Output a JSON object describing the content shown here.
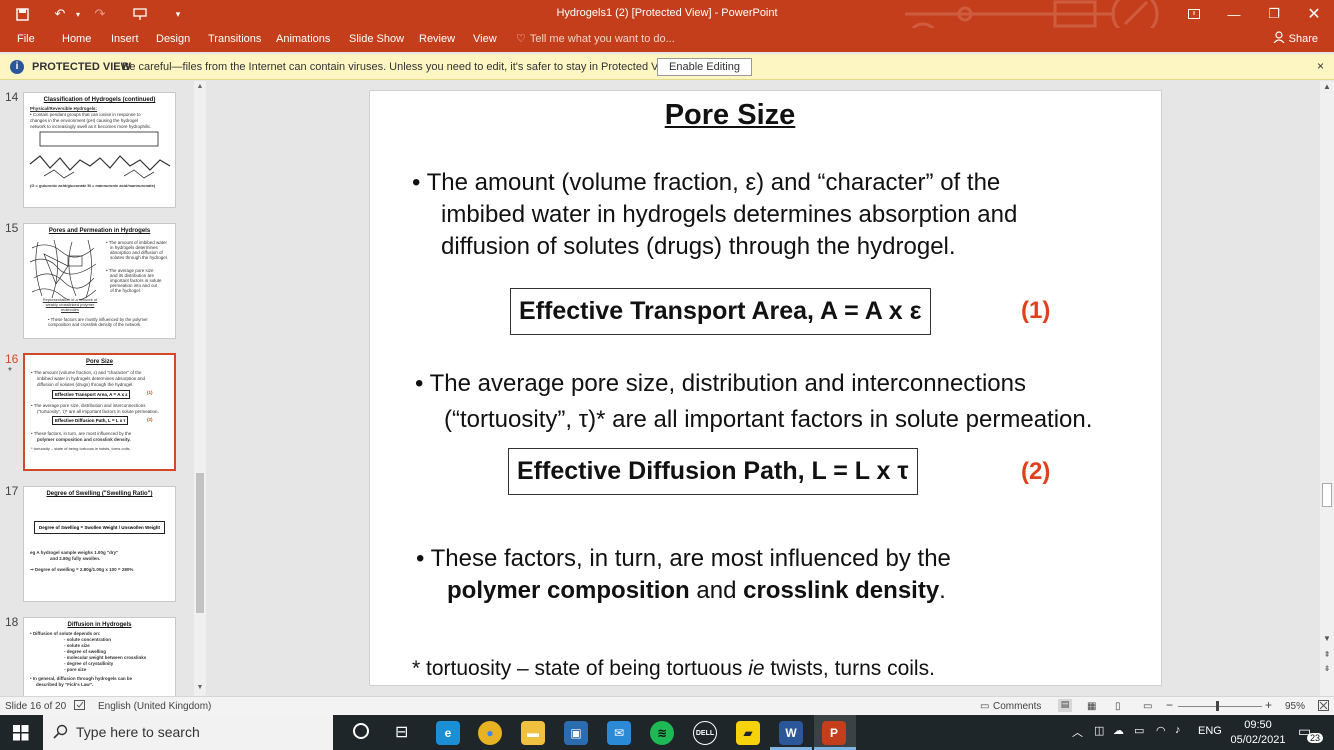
{
  "titlebar": {
    "title": "Hydrogels1 (2) [Protected View] - PowerPoint",
    "save_icon": "save-icon",
    "undo_icon": "undo-icon",
    "redo_icon": "redo-icon",
    "presenter_icon": "presenter-icon",
    "customize_icon": "customize-icon",
    "ribbon_display_icon": "ribbon-display-icon",
    "minimize_icon": "minimize-icon",
    "restore_icon": "restore-icon",
    "close_icon": "close-icon"
  },
  "ribbon": {
    "tabs": [
      {
        "label": "File"
      },
      {
        "label": "Home"
      },
      {
        "label": "Insert"
      },
      {
        "label": "Design"
      },
      {
        "label": "Transitions"
      },
      {
        "label": "Animations"
      },
      {
        "label": "Slide Show"
      },
      {
        "label": "Review"
      },
      {
        "label": "View"
      }
    ],
    "tell_me": "Tell me what you want to do...",
    "share": "Share"
  },
  "banner": {
    "label": "PROTECTED VIEW",
    "message": "Be careful—files from the Internet can contain viruses. Unless you need to edit, it's safer to stay in Protected View.",
    "enable_button": "Enable Editing",
    "close": "×"
  },
  "thumbnails": [
    {
      "number": "14",
      "title": "Classification of Hydrogels (continued)",
      "subtitle": "Physical/Reversible Hydrogels:",
      "lines": [
        "• Contain pendant groups that can ionise in response to",
        "changes in the environment (pH) causing the hydrogel",
        "network to increasingly swell as it becomes more hydrophilic."
      ],
      "footer": "(G = guluronic acid/gluconate    M = mannuronic acid/mannuronate)"
    },
    {
      "number": "15",
      "title": "Pores and Permeation in Hydrogels",
      "lines": [
        "• The amount of imbibed water",
        "in hydrogels determines",
        "absorption and diffusion of",
        "solutes through the hydrogel.",
        "• The average pore size",
        "and its distribution are",
        "important factors in solute",
        "permeation into and out",
        "of the hydrogel."
      ],
      "caption": "Representation of a network of weakly crosslinked polymer molecules",
      "footer": "• These factors are mostly influenced by the polymer composition and crosslink density of the network."
    },
    {
      "number": "16",
      "title": "Pore Size",
      "lines": [
        "• The amount (volume fraction, ε) and \"character\" of the",
        "imbibed water in hydrogels determines absorption and",
        "diffusion of solutes (drugs) through the hydrogel."
      ],
      "box1": "Effective Transport Area, A = A x ε",
      "lines2": [
        "• The average pore size, distribution and interconnections",
        "(\"tortuosity\", τ)* are all important factors in solute permeation."
      ],
      "box2": "Effective Diffusion Path, L = L x τ",
      "lines3": [
        "• These factors, in turn, are most influenced by the",
        "polymer composition and crosslink density."
      ],
      "footer": "* tortuosity – state of being tortuous ie twists, turns coils."
    },
    {
      "number": "17",
      "title": "Degree of Swelling (\"Swelling Ratio\")",
      "formula": "Degree of Swelling  =  Swollen Weight / Unswollen Weight",
      "lines": [
        "eg   A hydrogel sample weighs 1.00g \"dry\"",
        "and 2.80g fully swollen.",
        "⇒   Degree of swelling  =  2.80g/1.00g  x 100  =  280%"
      ]
    },
    {
      "number": "18",
      "title": "Diffusion in Hydrogels",
      "lines": [
        "• Diffusion of solute depends on:",
        "- solute concentration",
        "- solute size",
        "- degree of swelling",
        "- molecular weight between crosslinks",
        "- degree of crystallinity",
        "- pore size",
        "• In general, diffusion through hydrogels can be",
        "described by \"Fick's Law\"."
      ]
    }
  ],
  "slide": {
    "title": "Pore Size",
    "bullet1": {
      "line1": "•  The amount (volume fraction, ε) and “character” of the",
      "line2": "imbibed water in hydrogels determines absorption and",
      "line3": "diffusion of solutes (drugs) through the hydrogel."
    },
    "box1": "Effective Transport Area, A = A x ε",
    "eq1": "(1)",
    "bullet2": {
      "line1": "•  The average pore size, distribution and interconnections",
      "line2": "(“tortuosity”, τ)* are all important factors in solute permeation."
    },
    "box2": "Effective Diffusion Path, L = L x τ",
    "eq2": "(2)",
    "bullet3": {
      "line1": "•  These factors, in turn, are most influenced by the",
      "bold1": "polymer composition",
      "mid": " and ",
      "bold2": "crosslink density",
      "end": "."
    },
    "footnote": {
      "pre": "* tortuosity – state of being tortuous ",
      "italic": "ie",
      "post": " twists, turns coils."
    }
  },
  "statusbar": {
    "slide_info": "Slide 16 of 20",
    "language": "English (United Kingdom)",
    "comments": "Comments",
    "zoom": "95%"
  },
  "taskbar": {
    "search_placeholder": "Type here to search",
    "language": "ENG",
    "time": "09:50",
    "date": "05/02/2021",
    "notifications": "23",
    "apps": [
      {
        "name": "edge",
        "label": "e",
        "color": "#1a8fd6"
      },
      {
        "name": "chrome",
        "label": "●",
        "color": "#e8b323"
      },
      {
        "name": "file-explorer",
        "label": "▬",
        "color": "#f0c040"
      },
      {
        "name": "store",
        "label": "▣",
        "color": "#2b6cb0"
      },
      {
        "name": "mail",
        "label": "✉",
        "color": "#2b8ad8"
      },
      {
        "name": "spotify",
        "label": "≋",
        "color": "#1db954"
      },
      {
        "name": "dell",
        "label": "DELL",
        "color": "#1f2629"
      },
      {
        "name": "sticky-notes",
        "label": "▰",
        "color": "#f5d20a"
      },
      {
        "name": "word",
        "label": "W",
        "color": "#2b579a"
      },
      {
        "name": "powerpoint",
        "label": "P",
        "color": "#c43e1c"
      }
    ]
  }
}
